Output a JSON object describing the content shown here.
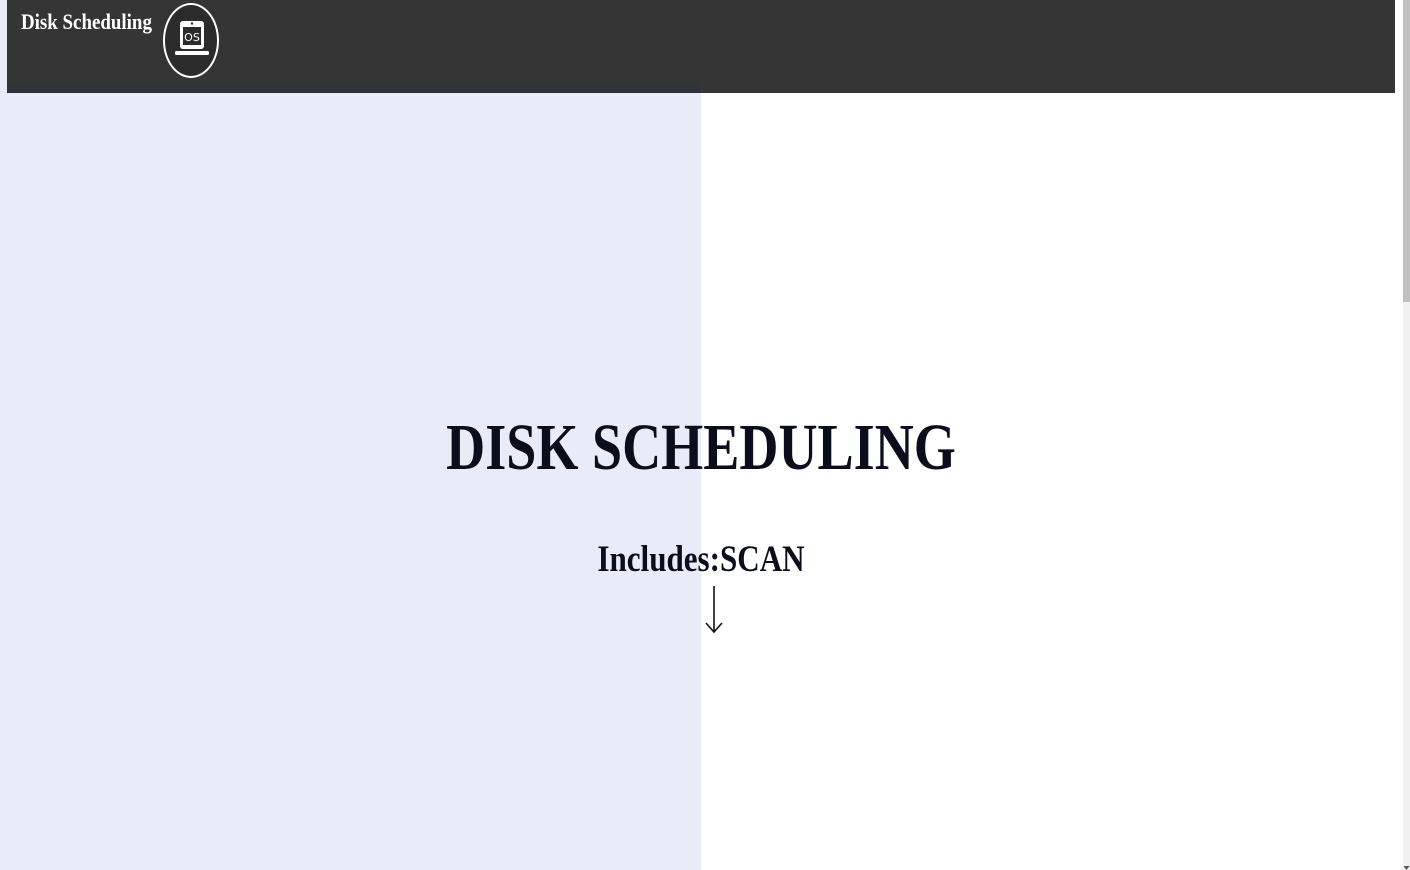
{
  "navbar": {
    "brand": "Disk Scheduling",
    "logo_icon": "os-laptop-icon",
    "logo_text": "OS"
  },
  "hero": {
    "title": "DISK SCHEDULING",
    "subtitle": "Includes:SCAN",
    "scroll_icon": "down-arrow-icon"
  },
  "colors": {
    "navbar_bg": "#353535",
    "left_panel_bg": "#e9ebf7",
    "right_panel_bg": "#ffffff",
    "text_dark": "#0a0d1c"
  }
}
